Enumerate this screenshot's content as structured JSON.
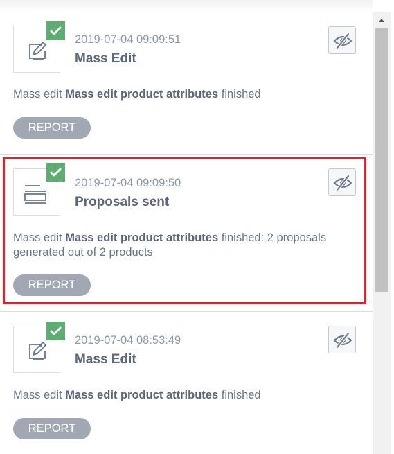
{
  "notifications": [
    {
      "icon": "edit-document-icon",
      "timestamp": "2019-07-04 09:09:51",
      "title": "Mass Edit",
      "message_prefix": "Mass edit ",
      "message_bold": "Mass edit product attributes",
      "message_suffix": " finished",
      "report_label": "REPORT",
      "status": "success"
    },
    {
      "icon": "proposals-icon",
      "timestamp": "2019-07-04 09:09:50",
      "title": "Proposals sent",
      "message_prefix": "Mass edit ",
      "message_bold": "Mass edit product attributes",
      "message_suffix": " finished: 2 proposals generated out of 2 products",
      "report_label": "REPORT",
      "status": "success"
    },
    {
      "icon": "edit-document-icon",
      "timestamp": "2019-07-04 08:53:49",
      "title": "Mass Edit",
      "message_prefix": "Mass edit ",
      "message_bold": "Mass edit product attributes",
      "message_suffix": " finished",
      "report_label": "REPORT",
      "status": "success"
    }
  ],
  "colors": {
    "success_badge": "#5fac72",
    "highlight_border": "#e0202c",
    "report_button": "#a1a8b4",
    "text": "#67768a"
  },
  "icons": {
    "mark_read": "eye-slash-icon",
    "status": "checkmark-icon",
    "scroll_up": "scroll-up-arrow-icon"
  }
}
